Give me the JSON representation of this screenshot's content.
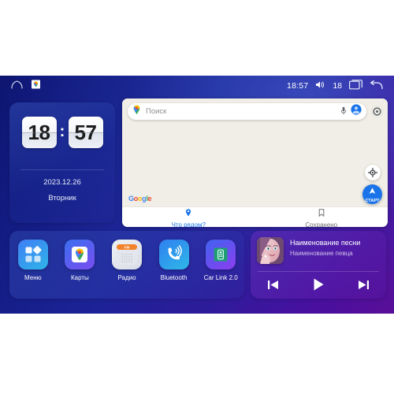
{
  "statusbar": {
    "home_icon": "home-icon",
    "notification_icon": "google-maps-notification-icon",
    "time": "18:57",
    "volume_icon": "volume-icon",
    "volume_level": "18",
    "recents_icon": "recents-icon",
    "back_icon": "back-icon"
  },
  "clock_widget": {
    "hours": "18",
    "colon": ":",
    "minutes": "57",
    "date": "2023.12.26",
    "weekday": "Вторник"
  },
  "map_widget": {
    "search_placeholder": "Поиск",
    "pin_icon": "map-pin-icon",
    "mic_icon": "microphone-icon",
    "avatar_icon": "account-avatar-icon",
    "settings_icon": "map-settings-icon",
    "locate_icon": "locate-me-icon",
    "google_logo": [
      "G",
      "o",
      "o",
      "g",
      "l",
      "e"
    ],
    "start_button": {
      "label": "СТАРТ",
      "icon": "navigation-arrow-icon",
      "color": "#1a73e8"
    },
    "tabs": [
      {
        "label": "Что рядом?",
        "icon": "nearby-pin-icon",
        "active": true
      },
      {
        "label": "Сохранено",
        "icon": "bookmark-icon",
        "active": false
      }
    ]
  },
  "dock": {
    "apps": [
      {
        "label": "Меню",
        "icon": "menu-grid-icon"
      },
      {
        "label": "Карты",
        "icon": "maps-pin-icon"
      },
      {
        "label": "Радио",
        "icon": "radio-icon",
        "badge": "FM"
      },
      {
        "label": "Bluetooth",
        "icon": "bluetooth-phone-icon"
      },
      {
        "label": "Car Link 2.0",
        "icon": "car-link-phone-icon"
      }
    ]
  },
  "music_widget": {
    "album_art": "album-art-portrait",
    "title": "Наименование песни",
    "artist": "Наименование певца",
    "controls": [
      {
        "name": "previous-track-button",
        "icon": "skip-previous-icon"
      },
      {
        "name": "play-button",
        "icon": "play-icon"
      },
      {
        "name": "next-track-button",
        "icon": "skip-next-icon"
      }
    ]
  },
  "colors": {
    "bg_start": "#0d1570",
    "bg_end": "#5c0c96",
    "accent_blue": "#1a73e8",
    "map_bg": "#f1eee7"
  }
}
